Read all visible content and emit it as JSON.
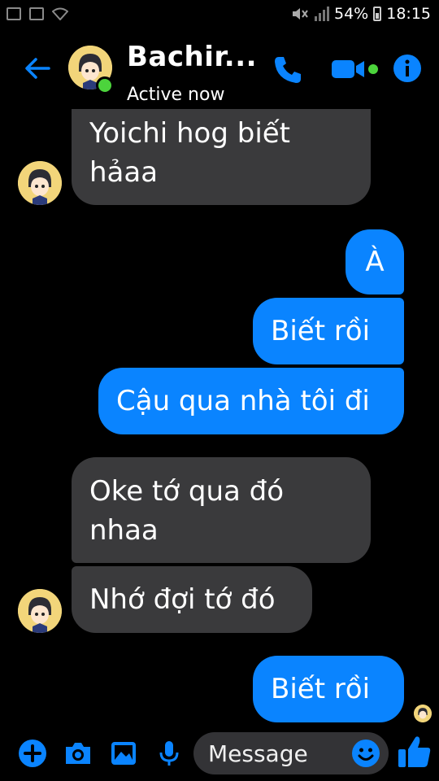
{
  "status_bar": {
    "battery_percent": "54%",
    "time": "18:15",
    "icons": [
      "gallery-icon",
      "flipboard-icon",
      "wifi-icon",
      "mute-icon",
      "signal-icon",
      "battery-icon"
    ]
  },
  "header": {
    "contact_name": "Bachir...",
    "status": "Active now",
    "icons": [
      "back-arrow-icon",
      "phone-icon",
      "video-call-icon",
      "info-icon"
    ],
    "accent_color": "#0a84ff",
    "online_color": "#4cd43c"
  },
  "messages": [
    {
      "side": "incoming",
      "text": "Yoichi hog biết hảaa"
    },
    {
      "side": "outgoing",
      "text": "À"
    },
    {
      "side": "outgoing",
      "text": "Biết rồi"
    },
    {
      "side": "outgoing",
      "text": "Cậu qua nhà tôi đi"
    },
    {
      "side": "incoming",
      "text": "Oke tớ qua đó nhaa"
    },
    {
      "side": "incoming",
      "text": "Nhớ đợi tớ đó"
    },
    {
      "side": "outgoing",
      "text": "Biết rồi"
    }
  ],
  "composer": {
    "placeholder": "Message",
    "icons": [
      "plus-icon",
      "camera-icon",
      "gallery-icon",
      "mic-icon",
      "emoji-icon",
      "thumbs-up-icon"
    ]
  },
  "colors": {
    "background": "#000000",
    "incoming_bubble": "#3a3a3c",
    "outgoing_bubble": "#0a84ff"
  }
}
